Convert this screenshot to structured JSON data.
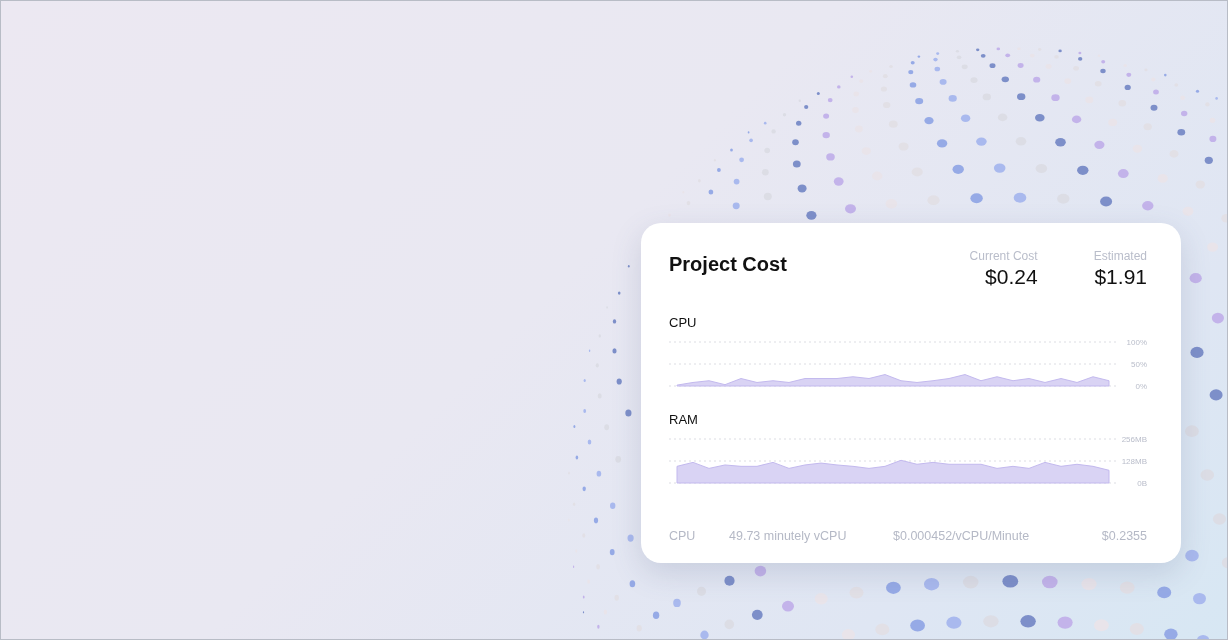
{
  "card": {
    "title": "Project Cost",
    "stats": [
      {
        "label": "Current Cost",
        "value": "$0.24"
      },
      {
        "label": "Estimated",
        "value": "$1.91"
      }
    ],
    "charts": [
      {
        "chart_data": {
          "type": "area",
          "title": "CPU",
          "ylim": [
            0,
            100
          ],
          "yticks": [
            {
              "value": 0,
              "label": "0%"
            },
            {
              "value": 50,
              "label": "50%"
            },
            {
              "value": 100,
              "label": "100%"
            }
          ],
          "series": [
            {
              "color": "#d9d3f4",
              "values": [
                2,
                8,
                12,
                3,
                17,
                8,
                12,
                8,
                17,
                17,
                17,
                21,
                17,
                26,
                12,
                8,
                12,
                17,
                26,
                12,
                21,
                12,
                17,
                8,
                17,
                8,
                21,
                12
              ]
            }
          ]
        }
      },
      {
        "chart_data": {
          "type": "area",
          "title": "RAM",
          "ylim": [
            0,
            256
          ],
          "yticks": [
            {
              "value": 0,
              "label": "0B"
            },
            {
              "value": 128,
              "label": "128MB"
            },
            {
              "value": 256,
              "label": "256MB"
            }
          ],
          "series": [
            {
              "color": "#d9d3f4",
              "values": [
                97,
                120,
                85,
                105,
                97,
                97,
                120,
                85,
                105,
                116,
                105,
                97,
                85,
                97,
                132,
                109,
                120,
                109,
                109,
                109,
                85,
                97,
                85,
                120,
                97,
                109,
                97,
                74
              ]
            }
          ]
        }
      }
    ],
    "usage_rows": [
      {
        "resource": "CPU",
        "amount": "49.73 minutely vCPU",
        "rate": "$0.000452/vCPU/Minute",
        "cost": "$0.2355"
      }
    ]
  }
}
